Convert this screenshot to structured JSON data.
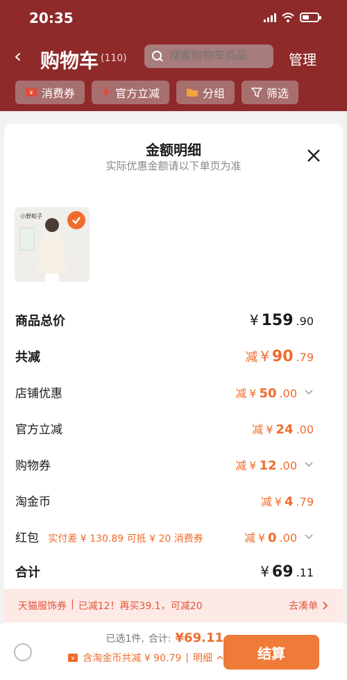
{
  "status_bar": {
    "time": "20:35"
  },
  "nav": {
    "back": "‹",
    "title": "购物车",
    "count": "(110)",
    "search_placeholder": "搜索购物车商品",
    "manage": "管理"
  },
  "filters": {
    "coupon": "消费券",
    "official": "官方立减",
    "group": "分组",
    "filter": "筛选"
  },
  "sheet": {
    "title": "金额明细",
    "subtitle": "实际优惠金额请以下单页为准",
    "thumb_brand": "小野和子",
    "rows": {
      "total_price": {
        "label": "商品总价",
        "yen": "¥",
        "main": "159",
        "dec": ".90"
      },
      "total_discount": {
        "label": "共减",
        "prefix": "减",
        "yen": "¥",
        "main": "90",
        "dec": ".79"
      },
      "store": {
        "label": "店铺优惠",
        "prefix": "减",
        "yen": "¥",
        "main": "50",
        "dec": ".00"
      },
      "official": {
        "label": "官方立减",
        "prefix": "减",
        "yen": "¥",
        "main": "24",
        "dec": ".00"
      },
      "voucher": {
        "label": "购物券",
        "prefix": "减",
        "yen": "¥",
        "main": "12",
        "dec": ".00"
      },
      "coin": {
        "label": "淘金币",
        "prefix": "减",
        "yen": "¥",
        "main": "4",
        "dec": ".79"
      },
      "redpack": {
        "label": "红包",
        "note": "实付差 ¥ 130.89 可抵 ¥ 20 消费券",
        "prefix": "减",
        "yen": "¥",
        "main": "0",
        "dec": ".00"
      },
      "subtotal": {
        "label": "合计",
        "yen": "¥",
        "main": "69",
        "dec": ".11"
      }
    },
    "promo": {
      "text_left": "天猫服饰券",
      "text_right": "已减12！再买39.1，可减20",
      "action": "去凑单"
    }
  },
  "bottom": {
    "selected": "已选1件,",
    "total_label": "合计:",
    "total_value": "¥69.11",
    "coin_note": "含淘金币共减 ¥ 90.79",
    "detail": "明细",
    "pay": "结算"
  },
  "colors": {
    "accent": "#ef6c2c",
    "header_dimmed": "#8f2a2a"
  },
  "icons": [
    "chevron-left-icon",
    "search-icon",
    "coupon-icon",
    "lightning-icon",
    "folder-icon",
    "filter-icon",
    "close-icon",
    "check-icon",
    "chevron-down-icon",
    "chevron-right-icon",
    "radio-icon"
  ]
}
